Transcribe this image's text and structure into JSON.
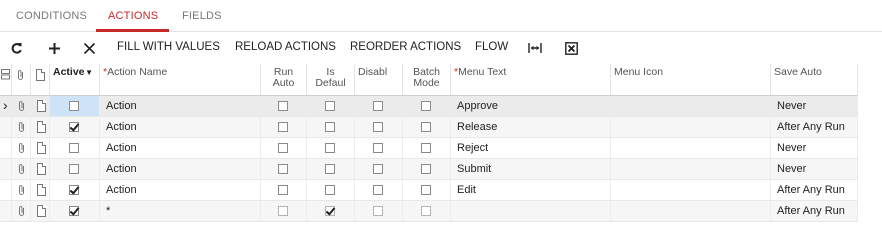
{
  "tabs": [
    {
      "label": "CONDITIONS",
      "active": false
    },
    {
      "label": "ACTIONS",
      "active": true
    },
    {
      "label": "FIELDS",
      "active": false
    }
  ],
  "toolbar": {
    "refresh_icon": "refresh-icon",
    "add_icon": "plus-icon",
    "delete_icon": "close-icon",
    "fill_label": "FILL WITH VALUES",
    "reload_label": "RELOAD ACTIONS",
    "reorder_label": "REORDER ACTIONS",
    "flow_label": "FLOW",
    "fit_icon": "fit-columns-icon",
    "export_icon": "export-excel-icon"
  },
  "columns": {
    "active": "Active",
    "action_name": "Action Name",
    "run_auto_1": "Run",
    "run_auto_2": "Auto",
    "is_default_1": "Is",
    "is_default_2": "Defaul",
    "disable": "Disabl",
    "batch_1": "Batch",
    "batch_2": "Mode",
    "menu_text": "Menu Text",
    "menu_icon": "Menu Icon",
    "save_auto": "Save Auto"
  },
  "rows": [
    {
      "active": false,
      "action_name": "Action",
      "run_auto": false,
      "is_default": false,
      "disable": false,
      "batch": false,
      "menu_text": "Approve",
      "menu_icon": "",
      "save_auto": "Never"
    },
    {
      "active": true,
      "action_name": "Action",
      "run_auto": false,
      "is_default": false,
      "disable": false,
      "batch": false,
      "menu_text": "Release",
      "menu_icon": "",
      "save_auto": "After Any Run"
    },
    {
      "active": false,
      "action_name": "Action",
      "run_auto": false,
      "is_default": false,
      "disable": false,
      "batch": false,
      "menu_text": "Reject",
      "menu_icon": "",
      "save_auto": "Never"
    },
    {
      "active": false,
      "action_name": "Action",
      "run_auto": false,
      "is_default": false,
      "disable": false,
      "batch": false,
      "menu_text": "Submit",
      "menu_icon": "",
      "save_auto": "Never"
    },
    {
      "active": true,
      "action_name": "Action",
      "run_auto": false,
      "is_default": false,
      "disable": false,
      "batch": false,
      "menu_text": "Edit",
      "menu_icon": "",
      "save_auto": "After Any Run"
    },
    {
      "active": true,
      "action_name": "*",
      "run_auto": false,
      "is_default": true,
      "disable": false,
      "batch": false,
      "menu_text": "",
      "menu_icon": "",
      "save_auto": "After Any Run"
    }
  ],
  "colors": {
    "accent": "#c62828",
    "selected_cell": "#cfe3f6",
    "selected_row": "#ebebeb"
  }
}
